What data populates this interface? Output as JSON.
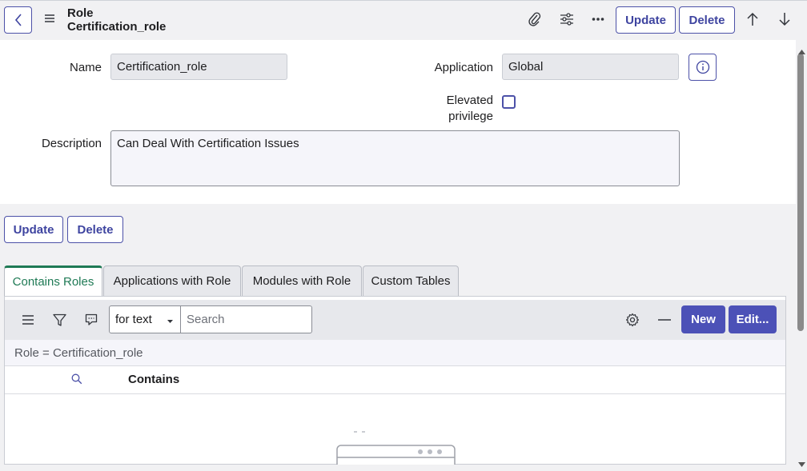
{
  "header": {
    "title_type": "Role",
    "title_record": "Certification_role",
    "update_label": "Update",
    "delete_label": "Delete"
  },
  "form": {
    "name_label": "Name",
    "name_value": "Certification_role",
    "application_label": "Application",
    "application_value": "Global",
    "elevated_label_line1": "Elevated",
    "elevated_label_line2": "privilege",
    "elevated_checked": false,
    "description_label": "Description",
    "description_value": "Can Deal With Certification Issues"
  },
  "actions": {
    "update_label": "Update",
    "delete_label": "Delete"
  },
  "tabs": [
    {
      "label": "Contains Roles",
      "active": true
    },
    {
      "label": "Applications with Role",
      "active": false
    },
    {
      "label": "Modules with Role",
      "active": false
    },
    {
      "label": "Custom Tables",
      "active": false
    }
  ],
  "list": {
    "search_field_option": "for text",
    "search_placeholder": "Search",
    "new_label": "New",
    "edit_label": "Edit...",
    "filter_text": "Role = Certification_role",
    "column_contains": "Contains"
  },
  "colors": {
    "accent": "#4c51b7",
    "active_tab": "#1f7a55"
  }
}
